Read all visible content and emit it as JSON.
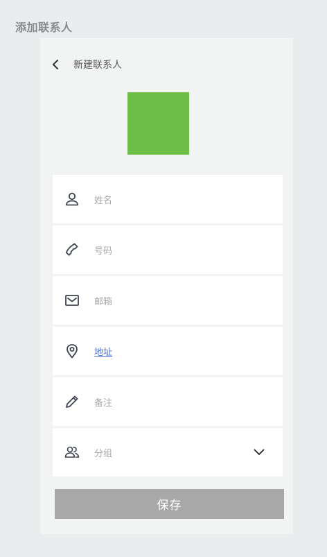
{
  "page": {
    "heading": "添加联系人"
  },
  "nav": {
    "back_icon": "chevron-left-icon",
    "title": "新建联系人"
  },
  "avatar": {
    "color": "#6cc04a"
  },
  "form": {
    "name": {
      "placeholder": "姓名",
      "icon": "person-icon"
    },
    "phone": {
      "placeholder": "号码",
      "icon": "phone-icon"
    },
    "email": {
      "placeholder": "邮箱",
      "icon": "mail-icon"
    },
    "address": {
      "placeholder": "地址",
      "icon": "location-pin-icon"
    },
    "note": {
      "placeholder": "备注",
      "icon": "pencil-icon"
    },
    "group": {
      "placeholder": "分组",
      "icon": "group-icon",
      "dropdown_icon": "chevron-down-icon"
    }
  },
  "actions": {
    "save_label": "保存",
    "save_color": "#a8a8a8"
  }
}
